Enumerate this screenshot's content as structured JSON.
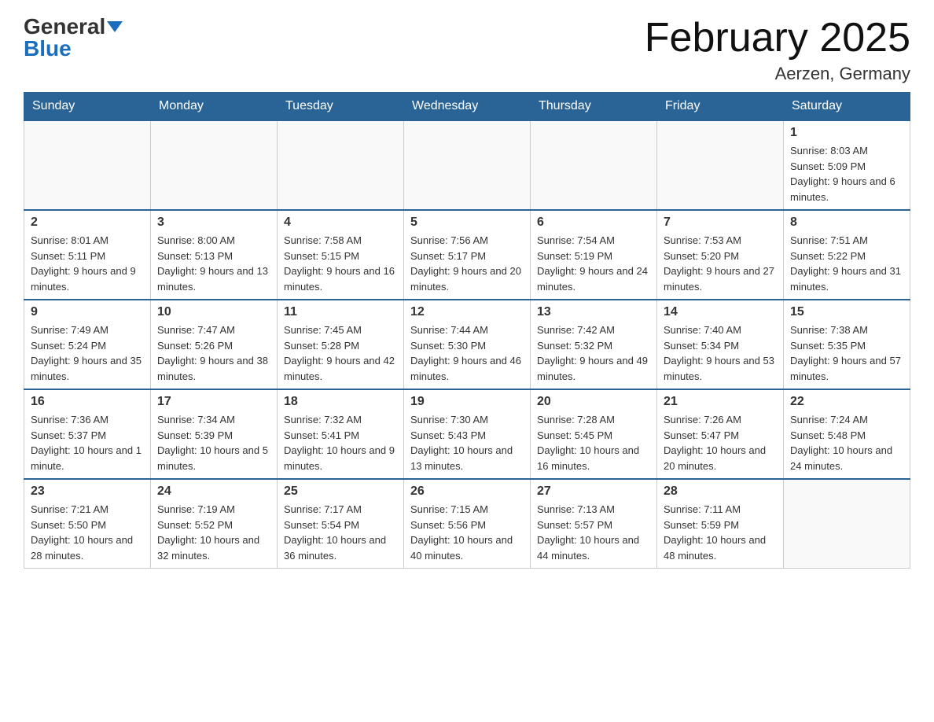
{
  "logo": {
    "general": "General",
    "blue": "Blue"
  },
  "title": {
    "month": "February 2025",
    "location": "Aerzen, Germany"
  },
  "weekdays": [
    "Sunday",
    "Monday",
    "Tuesday",
    "Wednesday",
    "Thursday",
    "Friday",
    "Saturday"
  ],
  "weeks": [
    [
      {
        "day": "",
        "info": ""
      },
      {
        "day": "",
        "info": ""
      },
      {
        "day": "",
        "info": ""
      },
      {
        "day": "",
        "info": ""
      },
      {
        "day": "",
        "info": ""
      },
      {
        "day": "",
        "info": ""
      },
      {
        "day": "1",
        "info": "Sunrise: 8:03 AM\nSunset: 5:09 PM\nDaylight: 9 hours and 6 minutes."
      }
    ],
    [
      {
        "day": "2",
        "info": "Sunrise: 8:01 AM\nSunset: 5:11 PM\nDaylight: 9 hours and 9 minutes."
      },
      {
        "day": "3",
        "info": "Sunrise: 8:00 AM\nSunset: 5:13 PM\nDaylight: 9 hours and 13 minutes."
      },
      {
        "day": "4",
        "info": "Sunrise: 7:58 AM\nSunset: 5:15 PM\nDaylight: 9 hours and 16 minutes."
      },
      {
        "day": "5",
        "info": "Sunrise: 7:56 AM\nSunset: 5:17 PM\nDaylight: 9 hours and 20 minutes."
      },
      {
        "day": "6",
        "info": "Sunrise: 7:54 AM\nSunset: 5:19 PM\nDaylight: 9 hours and 24 minutes."
      },
      {
        "day": "7",
        "info": "Sunrise: 7:53 AM\nSunset: 5:20 PM\nDaylight: 9 hours and 27 minutes."
      },
      {
        "day": "8",
        "info": "Sunrise: 7:51 AM\nSunset: 5:22 PM\nDaylight: 9 hours and 31 minutes."
      }
    ],
    [
      {
        "day": "9",
        "info": "Sunrise: 7:49 AM\nSunset: 5:24 PM\nDaylight: 9 hours and 35 minutes."
      },
      {
        "day": "10",
        "info": "Sunrise: 7:47 AM\nSunset: 5:26 PM\nDaylight: 9 hours and 38 minutes."
      },
      {
        "day": "11",
        "info": "Sunrise: 7:45 AM\nSunset: 5:28 PM\nDaylight: 9 hours and 42 minutes."
      },
      {
        "day": "12",
        "info": "Sunrise: 7:44 AM\nSunset: 5:30 PM\nDaylight: 9 hours and 46 minutes."
      },
      {
        "day": "13",
        "info": "Sunrise: 7:42 AM\nSunset: 5:32 PM\nDaylight: 9 hours and 49 minutes."
      },
      {
        "day": "14",
        "info": "Sunrise: 7:40 AM\nSunset: 5:34 PM\nDaylight: 9 hours and 53 minutes."
      },
      {
        "day": "15",
        "info": "Sunrise: 7:38 AM\nSunset: 5:35 PM\nDaylight: 9 hours and 57 minutes."
      }
    ],
    [
      {
        "day": "16",
        "info": "Sunrise: 7:36 AM\nSunset: 5:37 PM\nDaylight: 10 hours and 1 minute."
      },
      {
        "day": "17",
        "info": "Sunrise: 7:34 AM\nSunset: 5:39 PM\nDaylight: 10 hours and 5 minutes."
      },
      {
        "day": "18",
        "info": "Sunrise: 7:32 AM\nSunset: 5:41 PM\nDaylight: 10 hours and 9 minutes."
      },
      {
        "day": "19",
        "info": "Sunrise: 7:30 AM\nSunset: 5:43 PM\nDaylight: 10 hours and 13 minutes."
      },
      {
        "day": "20",
        "info": "Sunrise: 7:28 AM\nSunset: 5:45 PM\nDaylight: 10 hours and 16 minutes."
      },
      {
        "day": "21",
        "info": "Sunrise: 7:26 AM\nSunset: 5:47 PM\nDaylight: 10 hours and 20 minutes."
      },
      {
        "day": "22",
        "info": "Sunrise: 7:24 AM\nSunset: 5:48 PM\nDaylight: 10 hours and 24 minutes."
      }
    ],
    [
      {
        "day": "23",
        "info": "Sunrise: 7:21 AM\nSunset: 5:50 PM\nDaylight: 10 hours and 28 minutes."
      },
      {
        "day": "24",
        "info": "Sunrise: 7:19 AM\nSunset: 5:52 PM\nDaylight: 10 hours and 32 minutes."
      },
      {
        "day": "25",
        "info": "Sunrise: 7:17 AM\nSunset: 5:54 PM\nDaylight: 10 hours and 36 minutes."
      },
      {
        "day": "26",
        "info": "Sunrise: 7:15 AM\nSunset: 5:56 PM\nDaylight: 10 hours and 40 minutes."
      },
      {
        "day": "27",
        "info": "Sunrise: 7:13 AM\nSunset: 5:57 PM\nDaylight: 10 hours and 44 minutes."
      },
      {
        "day": "28",
        "info": "Sunrise: 7:11 AM\nSunset: 5:59 PM\nDaylight: 10 hours and 48 minutes."
      },
      {
        "day": "",
        "info": ""
      }
    ]
  ]
}
